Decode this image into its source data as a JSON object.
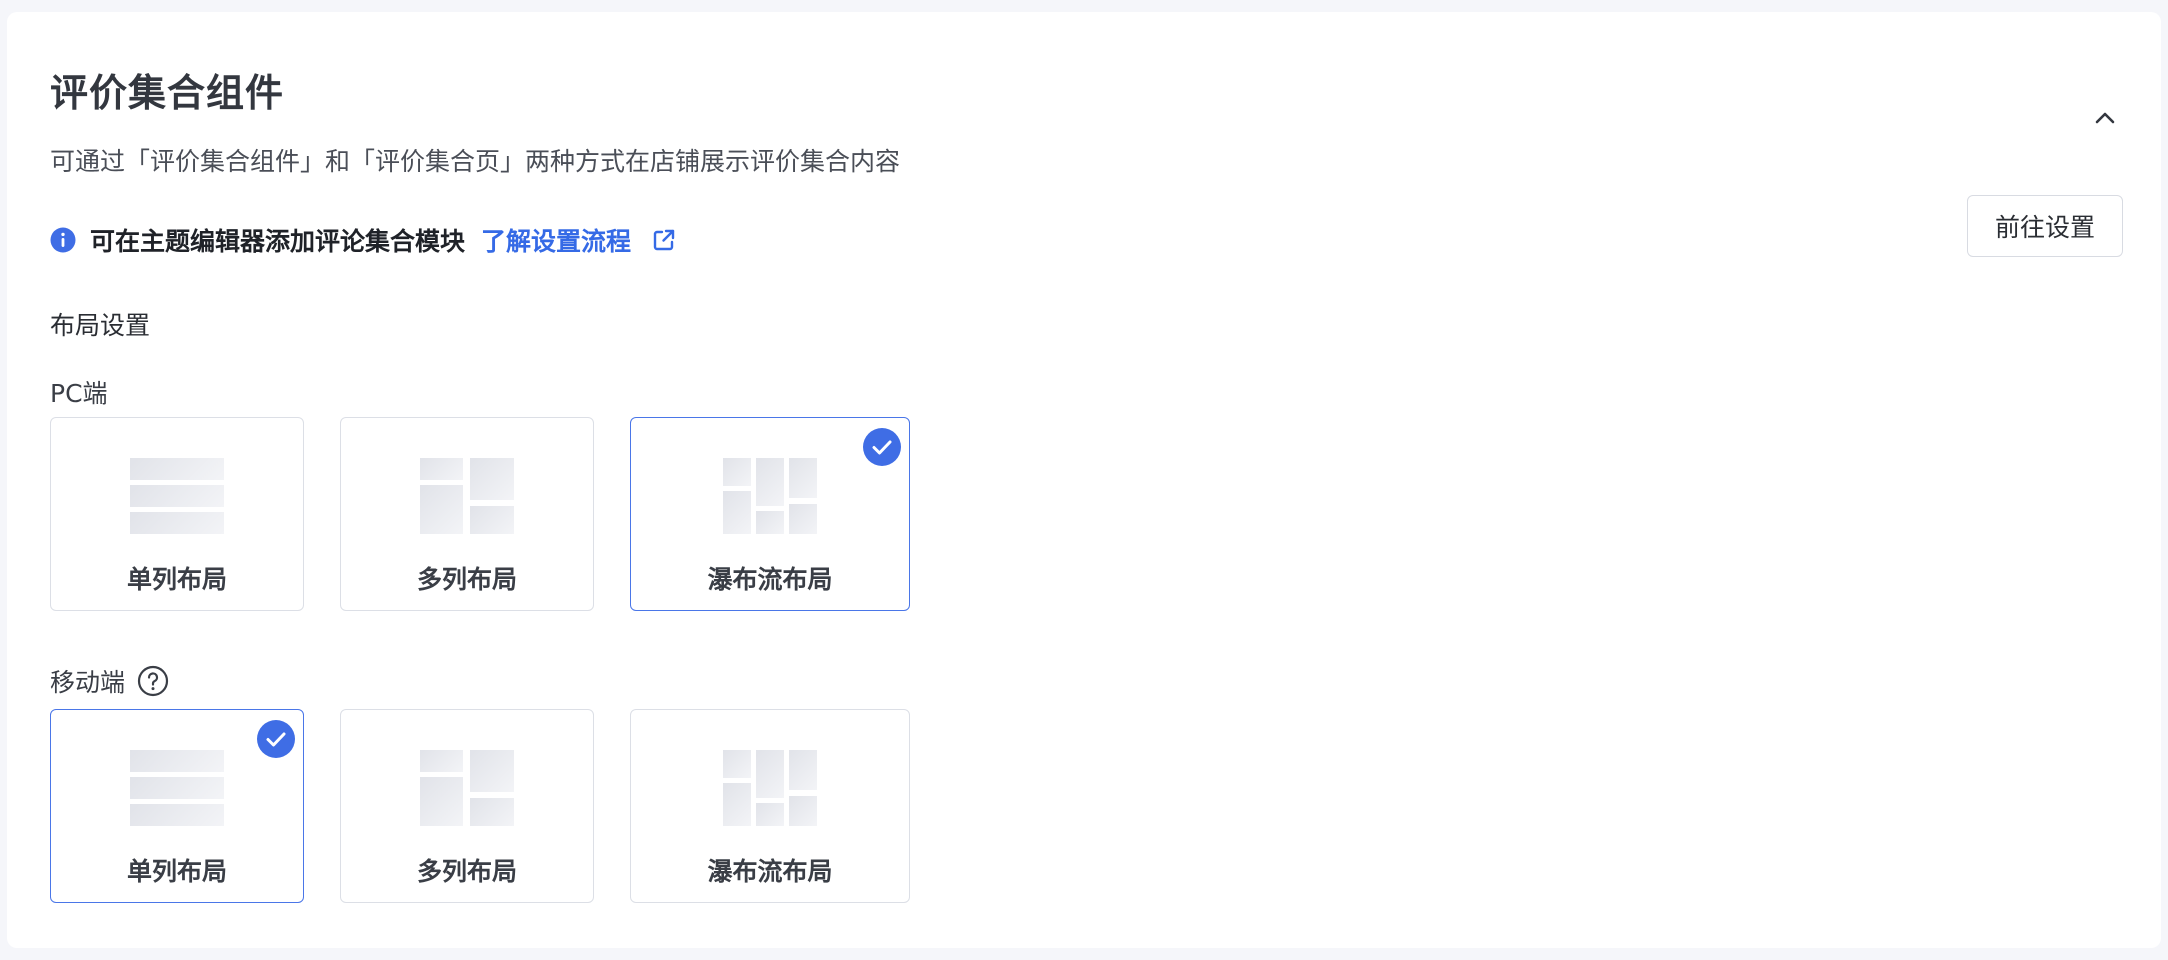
{
  "header": {
    "title": "评价集合组件",
    "subtitle": "可通过「评价集合组件」和「评价集合页」两种方式在店铺展示评价集合内容"
  },
  "tip": {
    "text": "可在主题编辑器添加评论集合模块",
    "link_label": "了解设置流程"
  },
  "actions": {
    "goto_label": "前往设置"
  },
  "layout": {
    "section_label": "布局设置",
    "pc": {
      "label": "PC端",
      "selected": "waterfall",
      "options": [
        {
          "id": "single",
          "label": "单列布局"
        },
        {
          "id": "multi",
          "label": "多列布局"
        },
        {
          "id": "waterfall",
          "label": "瀑布流布局"
        }
      ]
    },
    "mobile": {
      "label": "移动端",
      "selected": "single",
      "options": [
        {
          "id": "single",
          "label": "单列布局"
        },
        {
          "id": "multi",
          "label": "多列布局"
        },
        {
          "id": "waterfall",
          "label": "瀑布流布局"
        }
      ]
    }
  },
  "colors": {
    "accent": "#356ae6",
    "selected_border": "#4a76e8",
    "check_fill": "#3f6de5"
  },
  "icons": [
    "info-icon",
    "external-link-icon",
    "chevron-up-icon",
    "help-icon",
    "check-icon"
  ]
}
